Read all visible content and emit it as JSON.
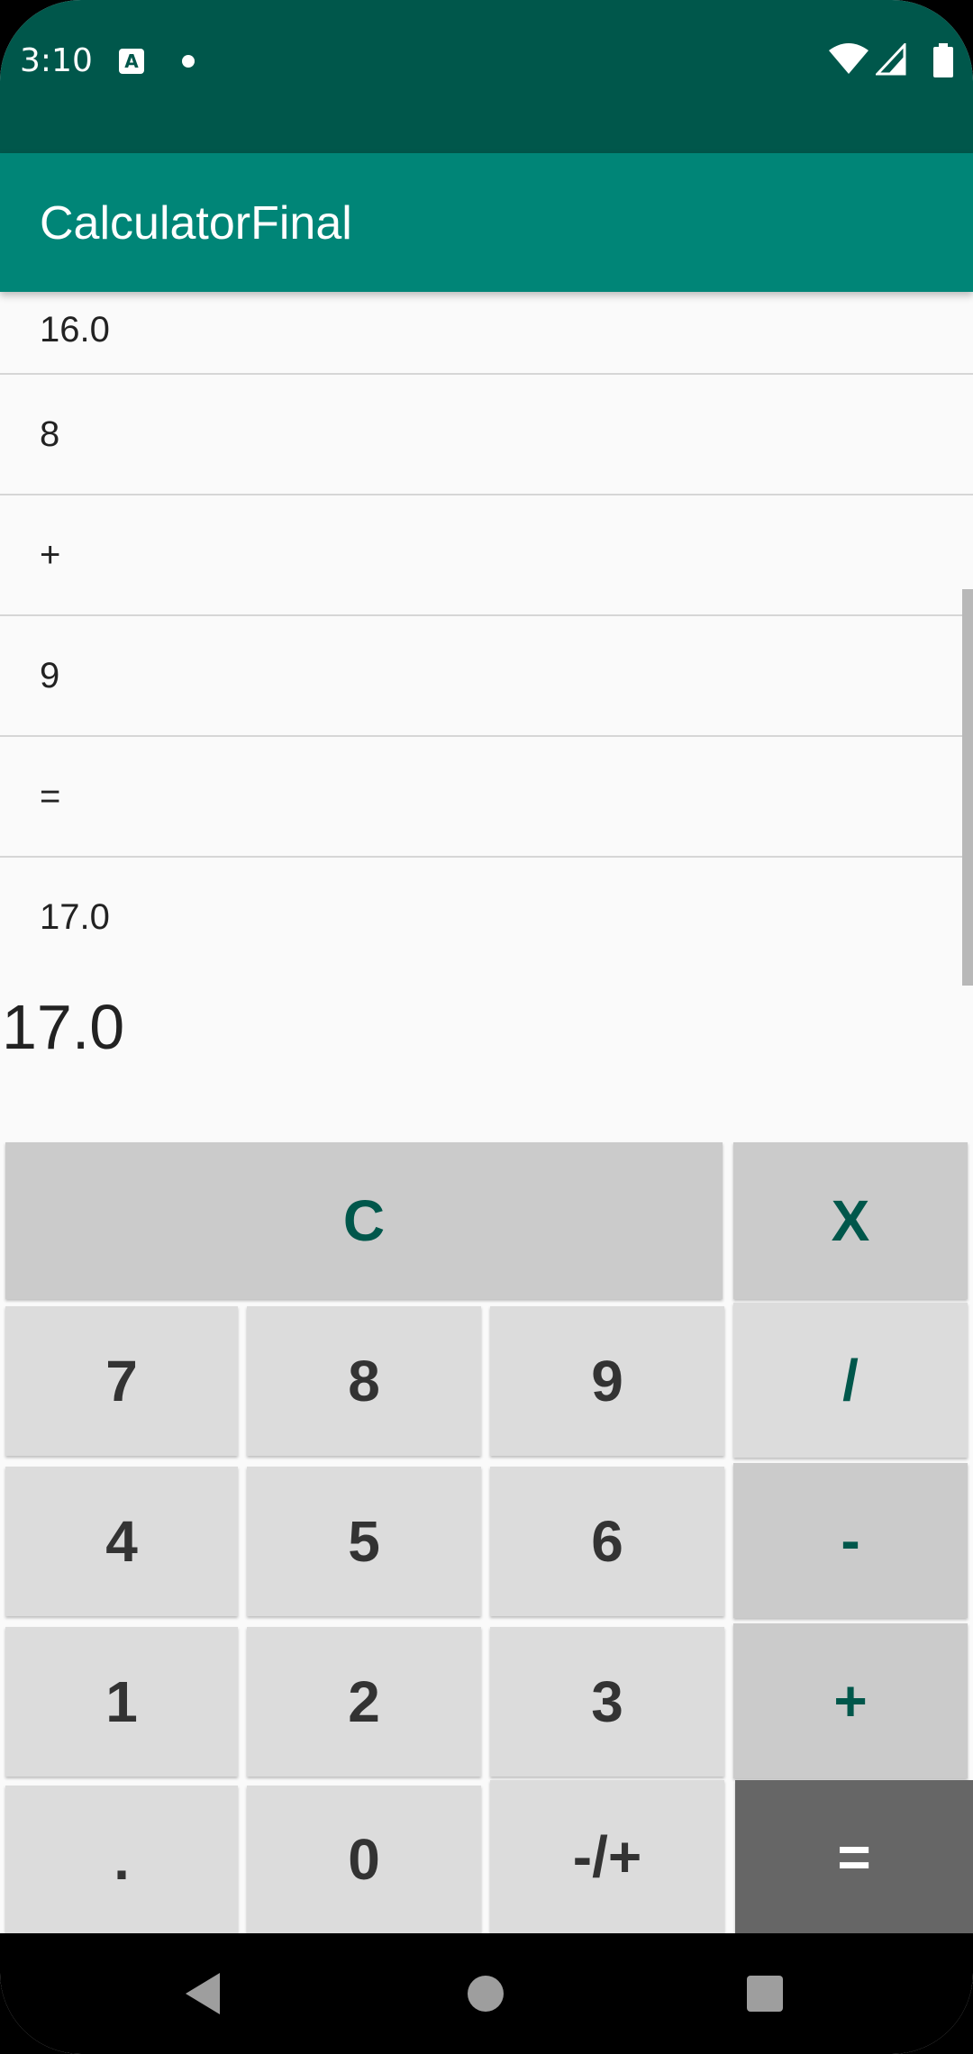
{
  "status_bar": {
    "time": "3:10",
    "notification_icon": "A",
    "icons": [
      "wifi-icon",
      "signal-icon",
      "battery-icon"
    ]
  },
  "app_bar": {
    "title": "CalculatorFinal"
  },
  "history": [
    "16.0",
    "8",
    "+",
    "9",
    "=",
    "17.0"
  ],
  "result": "17.0",
  "keys": {
    "clear": "C",
    "backspace": "X",
    "seven": "7",
    "eight": "8",
    "nine": "9",
    "divide": "/",
    "four": "4",
    "five": "5",
    "six": "6",
    "minus": "-",
    "one": "1",
    "two": "2",
    "three": "3",
    "plus": "+",
    "dot": ".",
    "zero": "0",
    "negate": "-/+",
    "equals": "="
  },
  "nav_bar": {
    "buttons": [
      "back-icon",
      "home-icon",
      "recents-icon"
    ]
  },
  "colors": {
    "status_bar": "#00574b",
    "app_bar": "#008577",
    "accent": "#00574b",
    "key": "#dcdcdc",
    "op_key": "#cbcbcb",
    "equals_key": "#666666"
  }
}
